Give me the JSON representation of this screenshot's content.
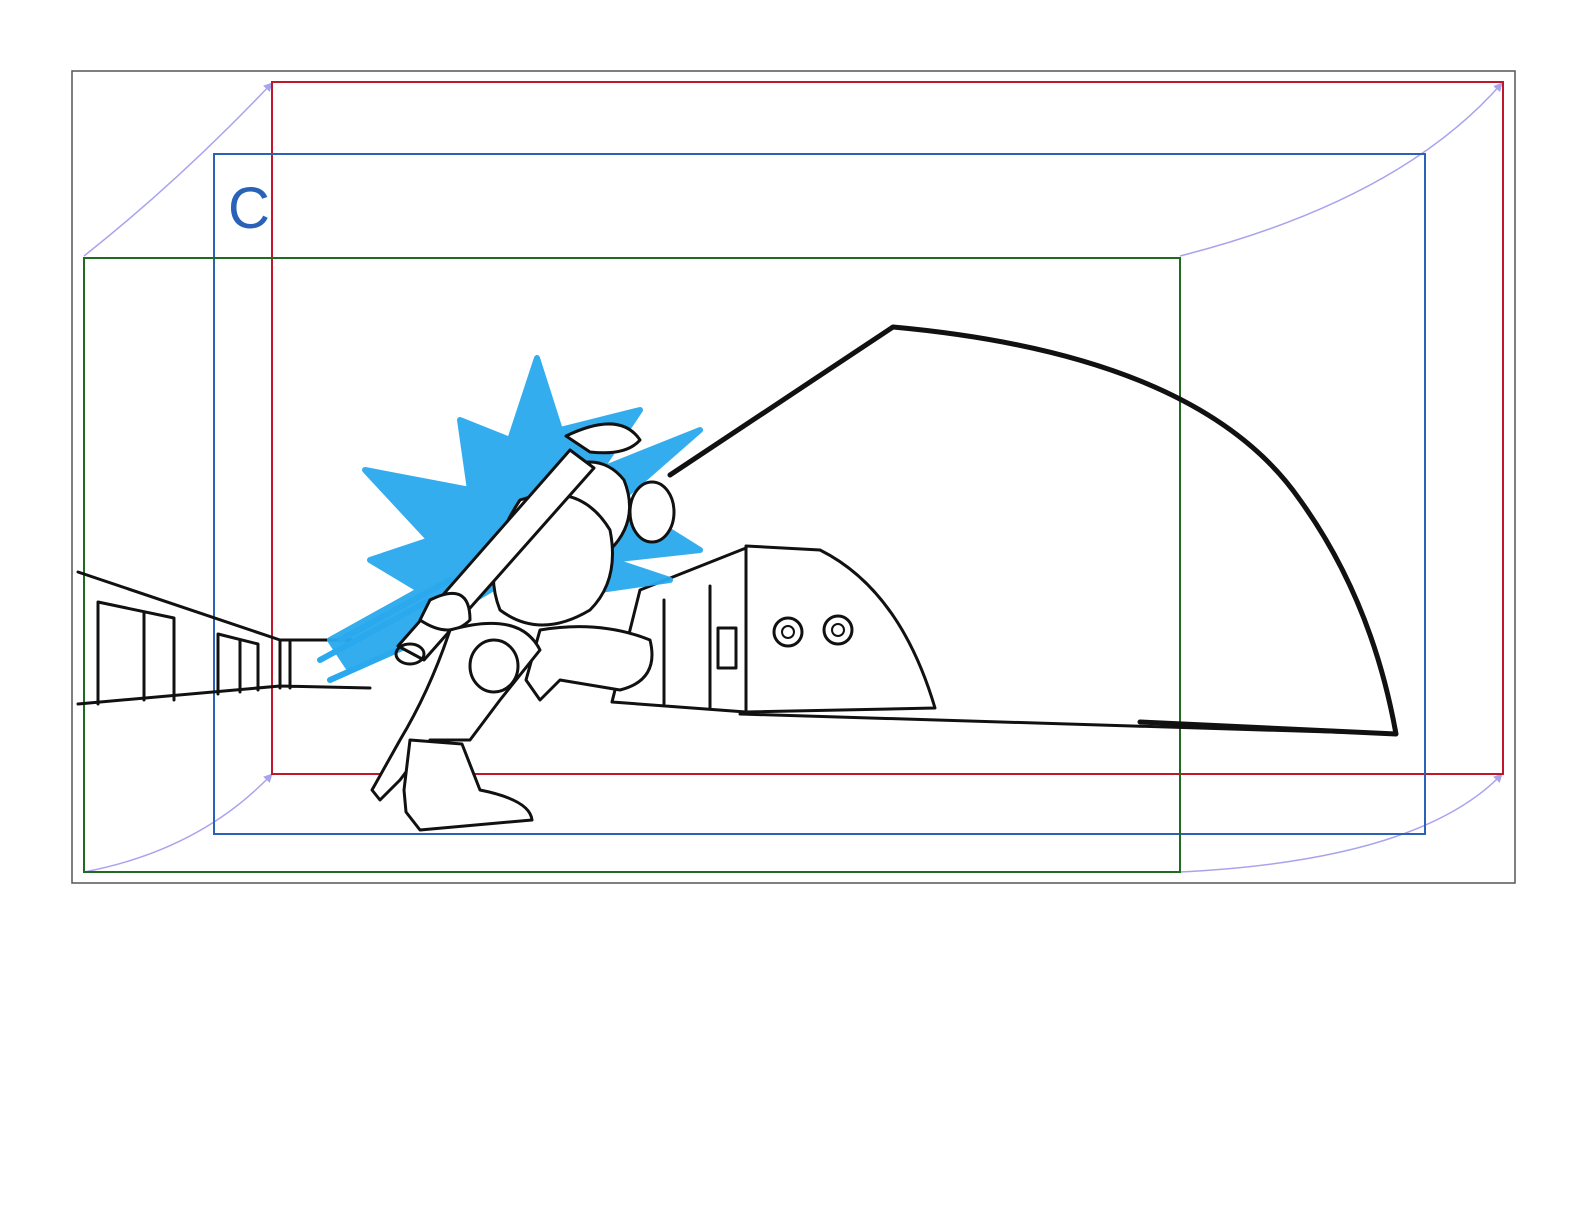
{
  "panel": {
    "label": "C"
  },
  "colors": {
    "panel_border": "#555555",
    "frame_red": "#c0182a",
    "frame_blue": "#2a62b8",
    "frame_green": "#1f6b1f",
    "guide_lavender": "#a9a3ee",
    "label_blue": "#2a62b8",
    "energy_blue": "#2aa9ee",
    "ink": "#111111"
  },
  "icons": {
    "panel_frame": "storyboard-panel-icon",
    "camera_frames": "nested-camera-frames-icon",
    "sketch": "character-sketch-icon"
  }
}
